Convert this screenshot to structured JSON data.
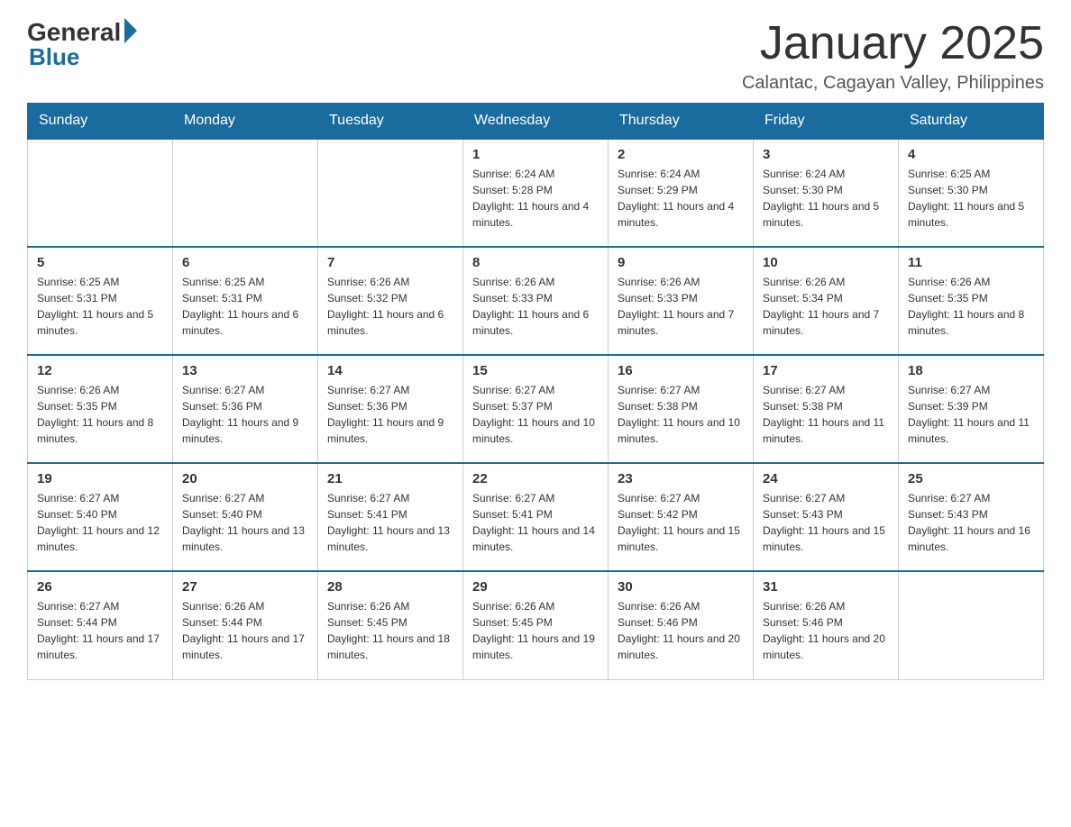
{
  "header": {
    "logo_text": "General",
    "logo_blue": "Blue",
    "month_title": "January 2025",
    "location": "Calantac, Cagayan Valley, Philippines"
  },
  "days_of_week": [
    "Sunday",
    "Monday",
    "Tuesday",
    "Wednesday",
    "Thursday",
    "Friday",
    "Saturday"
  ],
  "weeks": [
    [
      {
        "day": "",
        "info": ""
      },
      {
        "day": "",
        "info": ""
      },
      {
        "day": "",
        "info": ""
      },
      {
        "day": "1",
        "info": "Sunrise: 6:24 AM\nSunset: 5:28 PM\nDaylight: 11 hours and 4 minutes."
      },
      {
        "day": "2",
        "info": "Sunrise: 6:24 AM\nSunset: 5:29 PM\nDaylight: 11 hours and 4 minutes."
      },
      {
        "day": "3",
        "info": "Sunrise: 6:24 AM\nSunset: 5:30 PM\nDaylight: 11 hours and 5 minutes."
      },
      {
        "day": "4",
        "info": "Sunrise: 6:25 AM\nSunset: 5:30 PM\nDaylight: 11 hours and 5 minutes."
      }
    ],
    [
      {
        "day": "5",
        "info": "Sunrise: 6:25 AM\nSunset: 5:31 PM\nDaylight: 11 hours and 5 minutes."
      },
      {
        "day": "6",
        "info": "Sunrise: 6:25 AM\nSunset: 5:31 PM\nDaylight: 11 hours and 6 minutes."
      },
      {
        "day": "7",
        "info": "Sunrise: 6:26 AM\nSunset: 5:32 PM\nDaylight: 11 hours and 6 minutes."
      },
      {
        "day": "8",
        "info": "Sunrise: 6:26 AM\nSunset: 5:33 PM\nDaylight: 11 hours and 6 minutes."
      },
      {
        "day": "9",
        "info": "Sunrise: 6:26 AM\nSunset: 5:33 PM\nDaylight: 11 hours and 7 minutes."
      },
      {
        "day": "10",
        "info": "Sunrise: 6:26 AM\nSunset: 5:34 PM\nDaylight: 11 hours and 7 minutes."
      },
      {
        "day": "11",
        "info": "Sunrise: 6:26 AM\nSunset: 5:35 PM\nDaylight: 11 hours and 8 minutes."
      }
    ],
    [
      {
        "day": "12",
        "info": "Sunrise: 6:26 AM\nSunset: 5:35 PM\nDaylight: 11 hours and 8 minutes."
      },
      {
        "day": "13",
        "info": "Sunrise: 6:27 AM\nSunset: 5:36 PM\nDaylight: 11 hours and 9 minutes."
      },
      {
        "day": "14",
        "info": "Sunrise: 6:27 AM\nSunset: 5:36 PM\nDaylight: 11 hours and 9 minutes."
      },
      {
        "day": "15",
        "info": "Sunrise: 6:27 AM\nSunset: 5:37 PM\nDaylight: 11 hours and 10 minutes."
      },
      {
        "day": "16",
        "info": "Sunrise: 6:27 AM\nSunset: 5:38 PM\nDaylight: 11 hours and 10 minutes."
      },
      {
        "day": "17",
        "info": "Sunrise: 6:27 AM\nSunset: 5:38 PM\nDaylight: 11 hours and 11 minutes."
      },
      {
        "day": "18",
        "info": "Sunrise: 6:27 AM\nSunset: 5:39 PM\nDaylight: 11 hours and 11 minutes."
      }
    ],
    [
      {
        "day": "19",
        "info": "Sunrise: 6:27 AM\nSunset: 5:40 PM\nDaylight: 11 hours and 12 minutes."
      },
      {
        "day": "20",
        "info": "Sunrise: 6:27 AM\nSunset: 5:40 PM\nDaylight: 11 hours and 13 minutes."
      },
      {
        "day": "21",
        "info": "Sunrise: 6:27 AM\nSunset: 5:41 PM\nDaylight: 11 hours and 13 minutes."
      },
      {
        "day": "22",
        "info": "Sunrise: 6:27 AM\nSunset: 5:41 PM\nDaylight: 11 hours and 14 minutes."
      },
      {
        "day": "23",
        "info": "Sunrise: 6:27 AM\nSunset: 5:42 PM\nDaylight: 11 hours and 15 minutes."
      },
      {
        "day": "24",
        "info": "Sunrise: 6:27 AM\nSunset: 5:43 PM\nDaylight: 11 hours and 15 minutes."
      },
      {
        "day": "25",
        "info": "Sunrise: 6:27 AM\nSunset: 5:43 PM\nDaylight: 11 hours and 16 minutes."
      }
    ],
    [
      {
        "day": "26",
        "info": "Sunrise: 6:27 AM\nSunset: 5:44 PM\nDaylight: 11 hours and 17 minutes."
      },
      {
        "day": "27",
        "info": "Sunrise: 6:26 AM\nSunset: 5:44 PM\nDaylight: 11 hours and 17 minutes."
      },
      {
        "day": "28",
        "info": "Sunrise: 6:26 AM\nSunset: 5:45 PM\nDaylight: 11 hours and 18 minutes."
      },
      {
        "day": "29",
        "info": "Sunrise: 6:26 AM\nSunset: 5:45 PM\nDaylight: 11 hours and 19 minutes."
      },
      {
        "day": "30",
        "info": "Sunrise: 6:26 AM\nSunset: 5:46 PM\nDaylight: 11 hours and 20 minutes."
      },
      {
        "day": "31",
        "info": "Sunrise: 6:26 AM\nSunset: 5:46 PM\nDaylight: 11 hours and 20 minutes."
      },
      {
        "day": "",
        "info": ""
      }
    ]
  ]
}
